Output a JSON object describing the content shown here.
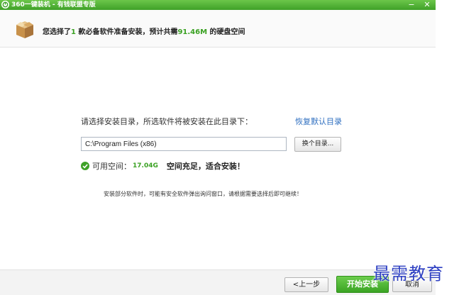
{
  "window": {
    "title": "360一键装机 - 有钱联盟专版",
    "minimize_label": "−",
    "close_label": "✕"
  },
  "header": {
    "msg_prefix": "您选择了",
    "selected_count": "1",
    "msg_middle": "款必备软件准备安装，预计共需",
    "required_size": "91.46M",
    "msg_suffix": "的硬盘空间"
  },
  "install": {
    "dir_label": "请选择安装目录，所选软件将被安装在此目录下：",
    "restore_default": "恢复默认目录",
    "path_value": "C:\\Program Files (x86)",
    "browse_button": "换个目录...",
    "available_label": "可用空间：",
    "available_space": "17.04G",
    "status_ok": "空间充足，适合安装！",
    "notice": "安装部分软件时，可能有安全软件弹出询问窗口，请根据需要选择后即可继续！"
  },
  "footer": {
    "prev_button": "<上一步",
    "start_button": "开始安装",
    "cancel_button": "取消"
  },
  "watermark": "最需教育",
  "colors": {
    "brand_green": "#3fa128",
    "accent_text_green": "#3aa122",
    "link_blue": "#2f6fc0",
    "watermark_blue": "#2d3fc2"
  },
  "icons": {
    "title_logo": "360-logo-icon",
    "header": "package-box-icon",
    "status": "check-circle-icon"
  }
}
